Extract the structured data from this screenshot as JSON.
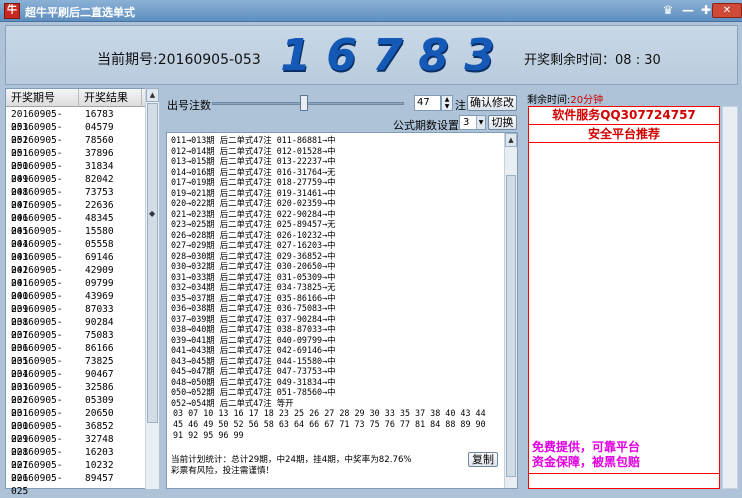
{
  "window": {
    "title": "超牛平刷后二直选单式",
    "icon_text": "牛"
  },
  "header": {
    "period_prefix": "当前期号:",
    "period": "20160905-053",
    "digits": [
      "1",
      "6",
      "7",
      "8",
      "3"
    ],
    "countdown_label": "开奖剩余时间：",
    "countdown": "08 : 30"
  },
  "history": {
    "col_period": "开奖期号",
    "col_result": "开奖结果",
    "rows": [
      [
        "20160905-053",
        "16783"
      ],
      [
        "20160905-052",
        "04579"
      ],
      [
        "20160905-051",
        "78560"
      ],
      [
        "20160905-050",
        "37896"
      ],
      [
        "20160905-049",
        "31834"
      ],
      [
        "20160905-048",
        "82042"
      ],
      [
        "20160905-047",
        "73753"
      ],
      [
        "20160905-046",
        "22636"
      ],
      [
        "20160905-045",
        "48345"
      ],
      [
        "20160905-044",
        "15580"
      ],
      [
        "20160905-043",
        "05558"
      ],
      [
        "20160905-042",
        "69146"
      ],
      [
        "20160905-041",
        "42909"
      ],
      [
        "20160905-040",
        "09799"
      ],
      [
        "20160905-039",
        "43969"
      ],
      [
        "20160905-038",
        "87033"
      ],
      [
        "20160905-037",
        "90284"
      ],
      [
        "20160905-036",
        "75083"
      ],
      [
        "20160905-035",
        "86166"
      ],
      [
        "20160905-034",
        "73825"
      ],
      [
        "20160905-033",
        "90467"
      ],
      [
        "20160905-032",
        "32586"
      ],
      [
        "20160905-031",
        "05309"
      ],
      [
        "20160905-030",
        "20650"
      ],
      [
        "20160905-029",
        "36852"
      ],
      [
        "20160905-028",
        "32748"
      ],
      [
        "20160905-027",
        "16203"
      ],
      [
        "20160905-026",
        "10232"
      ],
      [
        "20160905-025",
        "89457"
      ]
    ]
  },
  "controls": {
    "bet_count_label": "出号注数",
    "bet_count": "47",
    "bet_unit": "注",
    "confirm_button": "确认修改",
    "formula_label": "公式期数设置:",
    "formula_value": "3",
    "switch_button": "切换",
    "copy_button": "复制",
    "slider_level": 0.48
  },
  "plan": {
    "lines": [
      "011→013期 后二单式47注 011-86881→中",
      "012→014期 后二单式47注 012-01528→中",
      "013→015期 后二单式47注 013-22237→中",
      "014→016期 后二单式47注 016-31764→无",
      "017→019期 后二单式47注 018-27759→中",
      "019→021期 后二单式47注 019-31461→中",
      "020→022期 后二单式47注 020-02359→中",
      "021→023期 后二单式47注 022-90284→中",
      "023→025期 后二单式47注 025-89457→无",
      "026→028期 后二单式47注 026-10232→中",
      "027→029期 后二单式47注 027-16203→中",
      "028→030期 后二单式47注 029-36852→中",
      "030→032期 后二单式47注 030-20650→中",
      "031→033期 后二单式47注 031-05309→中",
      "032→034期 后二单式47注 034-73825→无",
      "035→037期 后二单式47注 035-86166→中",
      "036→038期 后二单式47注 036-75083→中",
      "037→039期 后二单式47注 037-90284→中",
      "038→040期 后二单式47注 038-87033→中",
      "039→041期 后二单式47注 040-09799→中",
      "041→043期 后二单式47注 042-69146→中",
      "043→045期 后二单式47注 044-15580→中",
      "045→047期 后二单式47注 047-73753→中",
      "048→050期 后二单式47注 049-31834→中",
      "050→052期 后二单式47注 051-78560→中",
      "052→054期 后二单式47注 等开"
    ],
    "numbers": "03 07 10 13 16 17 18 23 25 26 27 28 29 30 33 35 37 38 40 43 44 45 46 49 50 52 56 58 63 64 66 67 71 73 75 76 77 81 84 88 89 90 91 92 95 96 99",
    "summary": "当前计划统计：总计29期，中24期，挂4期，中奖率为82.76%\n彩票有风险，投注需谨慎！"
  },
  "side": {
    "remain_label": "剩余时间:",
    "remain_value": "20分钟",
    "service": "软件服务QQ307724757",
    "recommend": "安全平台推荐",
    "promo_line1": "免费提供，可靠平台",
    "promo_line2": "资金保障，被黑包赔"
  }
}
